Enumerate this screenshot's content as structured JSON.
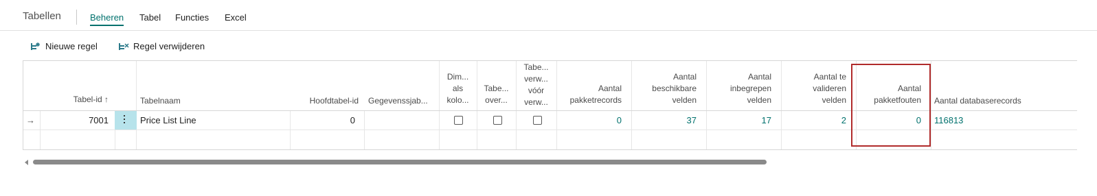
{
  "header": {
    "title": "Tabellen",
    "tabs": [
      "Beheren",
      "Tabel",
      "Functies",
      "Excel"
    ]
  },
  "actions": {
    "new_line": "Nieuwe regel",
    "delete_line": "Regel verwijderen"
  },
  "columns": {
    "table_id": "Tabel-id ↑",
    "table_name": "Tabelnaam",
    "main_table_id": "Hoofdtabel-id",
    "data_sheet": "Gegevenssjab...",
    "dim_as_cols_l1": "Dim...",
    "dim_as_cols_l2": "als",
    "dim_as_cols_l3": "kolo...",
    "table_over_l1": "Tabe...",
    "table_over_l2": "over...",
    "table_delete_l1": "Tabe...",
    "table_delete_l2": "verw...",
    "table_delete_l3": "vóór",
    "table_delete_l4": "verw...",
    "pkg_records_l1": "Aantal",
    "pkg_records_l2": "pakketrecords",
    "avail_fields_l1": "Aantal",
    "avail_fields_l2": "beschikbare",
    "avail_fields_l3": "velden",
    "incl_fields_l1": "Aantal",
    "incl_fields_l2": "inbegrepen",
    "incl_fields_l3": "velden",
    "validate_fields_l1": "Aantal te",
    "validate_fields_l2": "valideren",
    "validate_fields_l3": "velden",
    "pkg_errors_l1": "Aantal",
    "pkg_errors_l2": "pakketfouten",
    "db_records": "Aantal databaserecords"
  },
  "row": {
    "arrow": "→",
    "table_id": "7001",
    "table_name": "Price List Line",
    "main_table_id": "0",
    "pkg_records": "0",
    "avail_fields": "37",
    "incl_fields": "17",
    "validate_fields": "2",
    "pkg_errors": "0",
    "db_records": "116813"
  }
}
